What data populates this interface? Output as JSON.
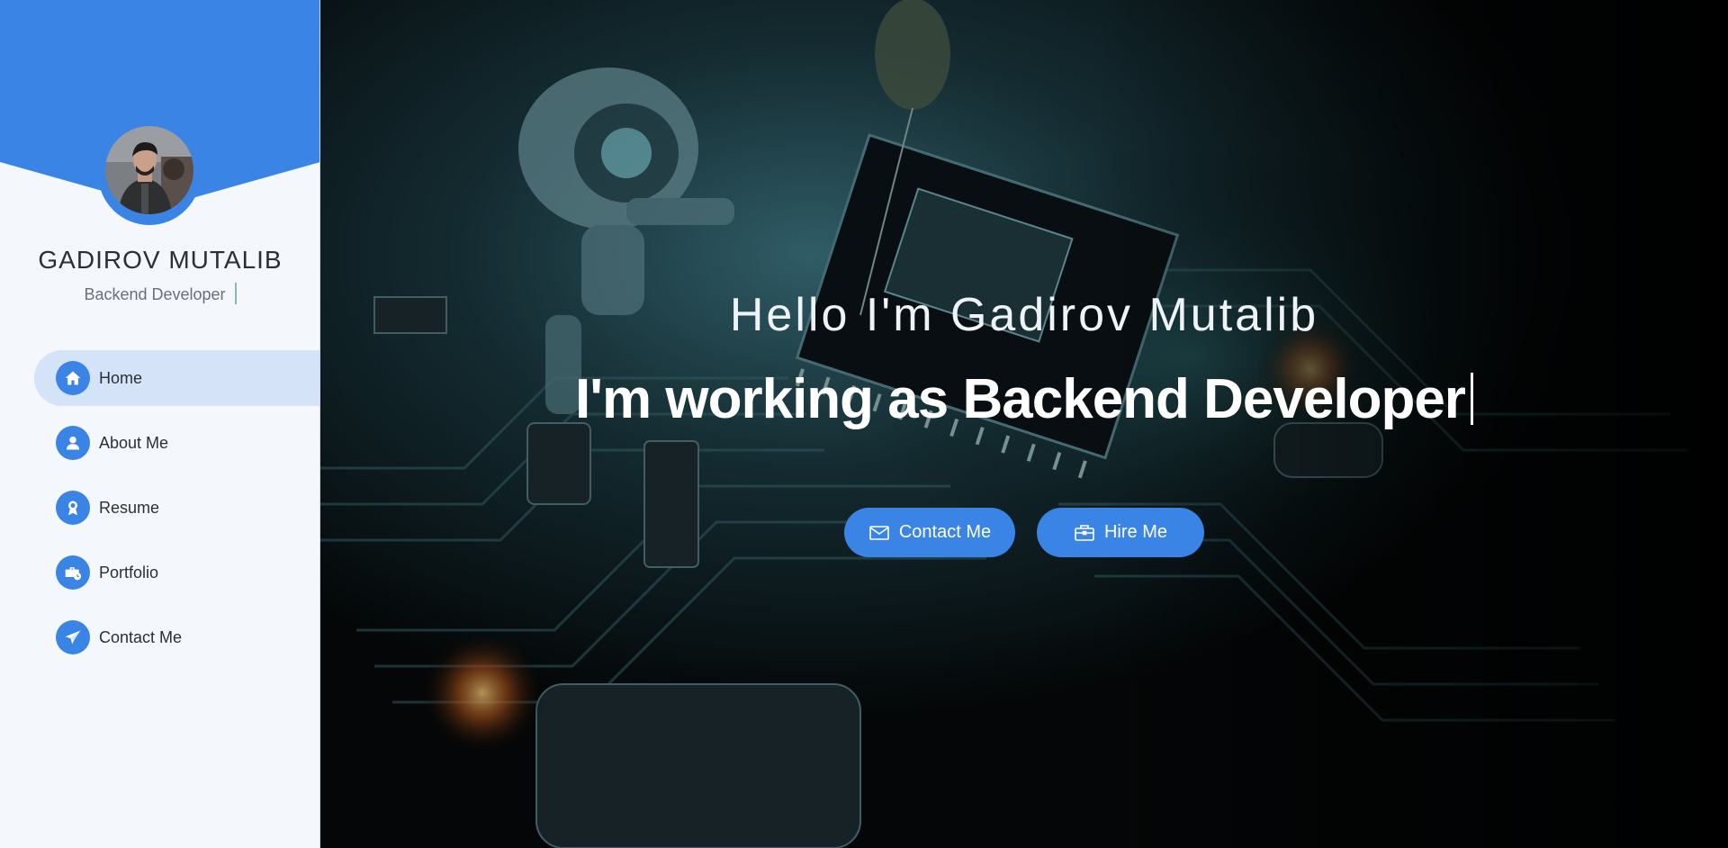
{
  "profile": {
    "name": "GADIROV MUTALIB",
    "role": "Backend Developer"
  },
  "nav": {
    "items": [
      {
        "label": "Home",
        "icon": "home-icon",
        "active": true
      },
      {
        "label": "About Me",
        "icon": "user-icon",
        "active": false
      },
      {
        "label": "Resume",
        "icon": "award-icon",
        "active": false
      },
      {
        "label": "Portfolio",
        "icon": "briefcase-clock-icon",
        "active": false
      },
      {
        "label": "Contact Me",
        "icon": "paper-plane-icon",
        "active": false
      }
    ]
  },
  "hero": {
    "greeting": "Hello I'm Gadirov Mutalib",
    "tagline_prefix": "I'm working as ",
    "tagline_role": "Backend Developer",
    "contact_button": "Contact Me",
    "hire_button": "Hire Me"
  },
  "colors": {
    "accent": "#3a84e6",
    "sidebar_bg": "#f4f7fc",
    "active_item_bg": "#d4e3f8",
    "text_dark": "#2b2f36"
  }
}
